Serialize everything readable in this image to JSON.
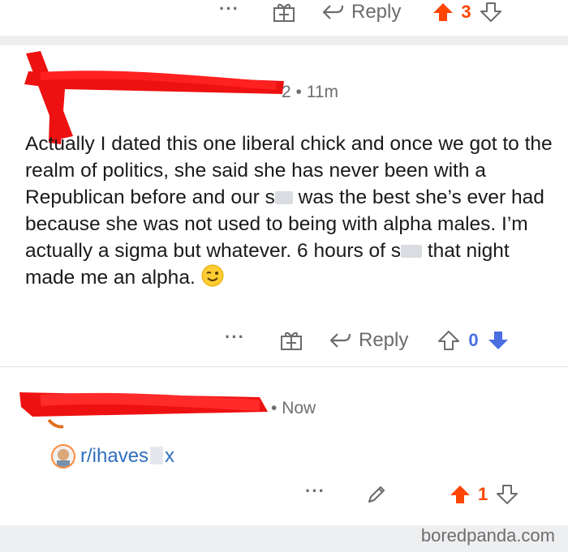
{
  "colors": {
    "upvote": "#ff4500",
    "downvote": "#4a6ee0",
    "link": "#2f6fbf",
    "muted": "#6b6b6b"
  },
  "top_actions": {
    "more": "···",
    "reply_label": "Reply",
    "score": "3",
    "gift_icon": "gift-icon",
    "reply_icon": "reply-arrow-icon",
    "up_icon": "upvote-filled-icon",
    "down_icon": "downvote-outline-icon"
  },
  "comment1": {
    "meta_tail": "2",
    "time": "11m",
    "body_parts": {
      "p1": "Actually I dated this one liberal chick and once we got to the realm of politics, she said she has never been with a Republican before and our s",
      "p2": " was the best she’s ever had because she was not used to being with alpha males. I’m actually a sigma but whatever. 6 hours of s",
      "p3": " that night made me an alpha. "
    },
    "emoji": "winking-face-emoji",
    "actions": {
      "more": "···",
      "reply_label": "Reply",
      "score": "0",
      "gift_icon": "gift-icon",
      "reply_icon": "reply-arrow-icon",
      "up_icon": "upvote-outline-icon",
      "down_icon": "downvote-filled-icon"
    }
  },
  "comment2": {
    "time": "Now",
    "subreddit_prefix": "r/ihaves",
    "subreddit_suffix": "x",
    "actions": {
      "more": "···",
      "score": "1",
      "edit_icon": "pencil-icon",
      "up_icon": "upvote-filled-icon",
      "down_icon": "downvote-outline-icon"
    }
  },
  "watermark": "boredpanda.com"
}
